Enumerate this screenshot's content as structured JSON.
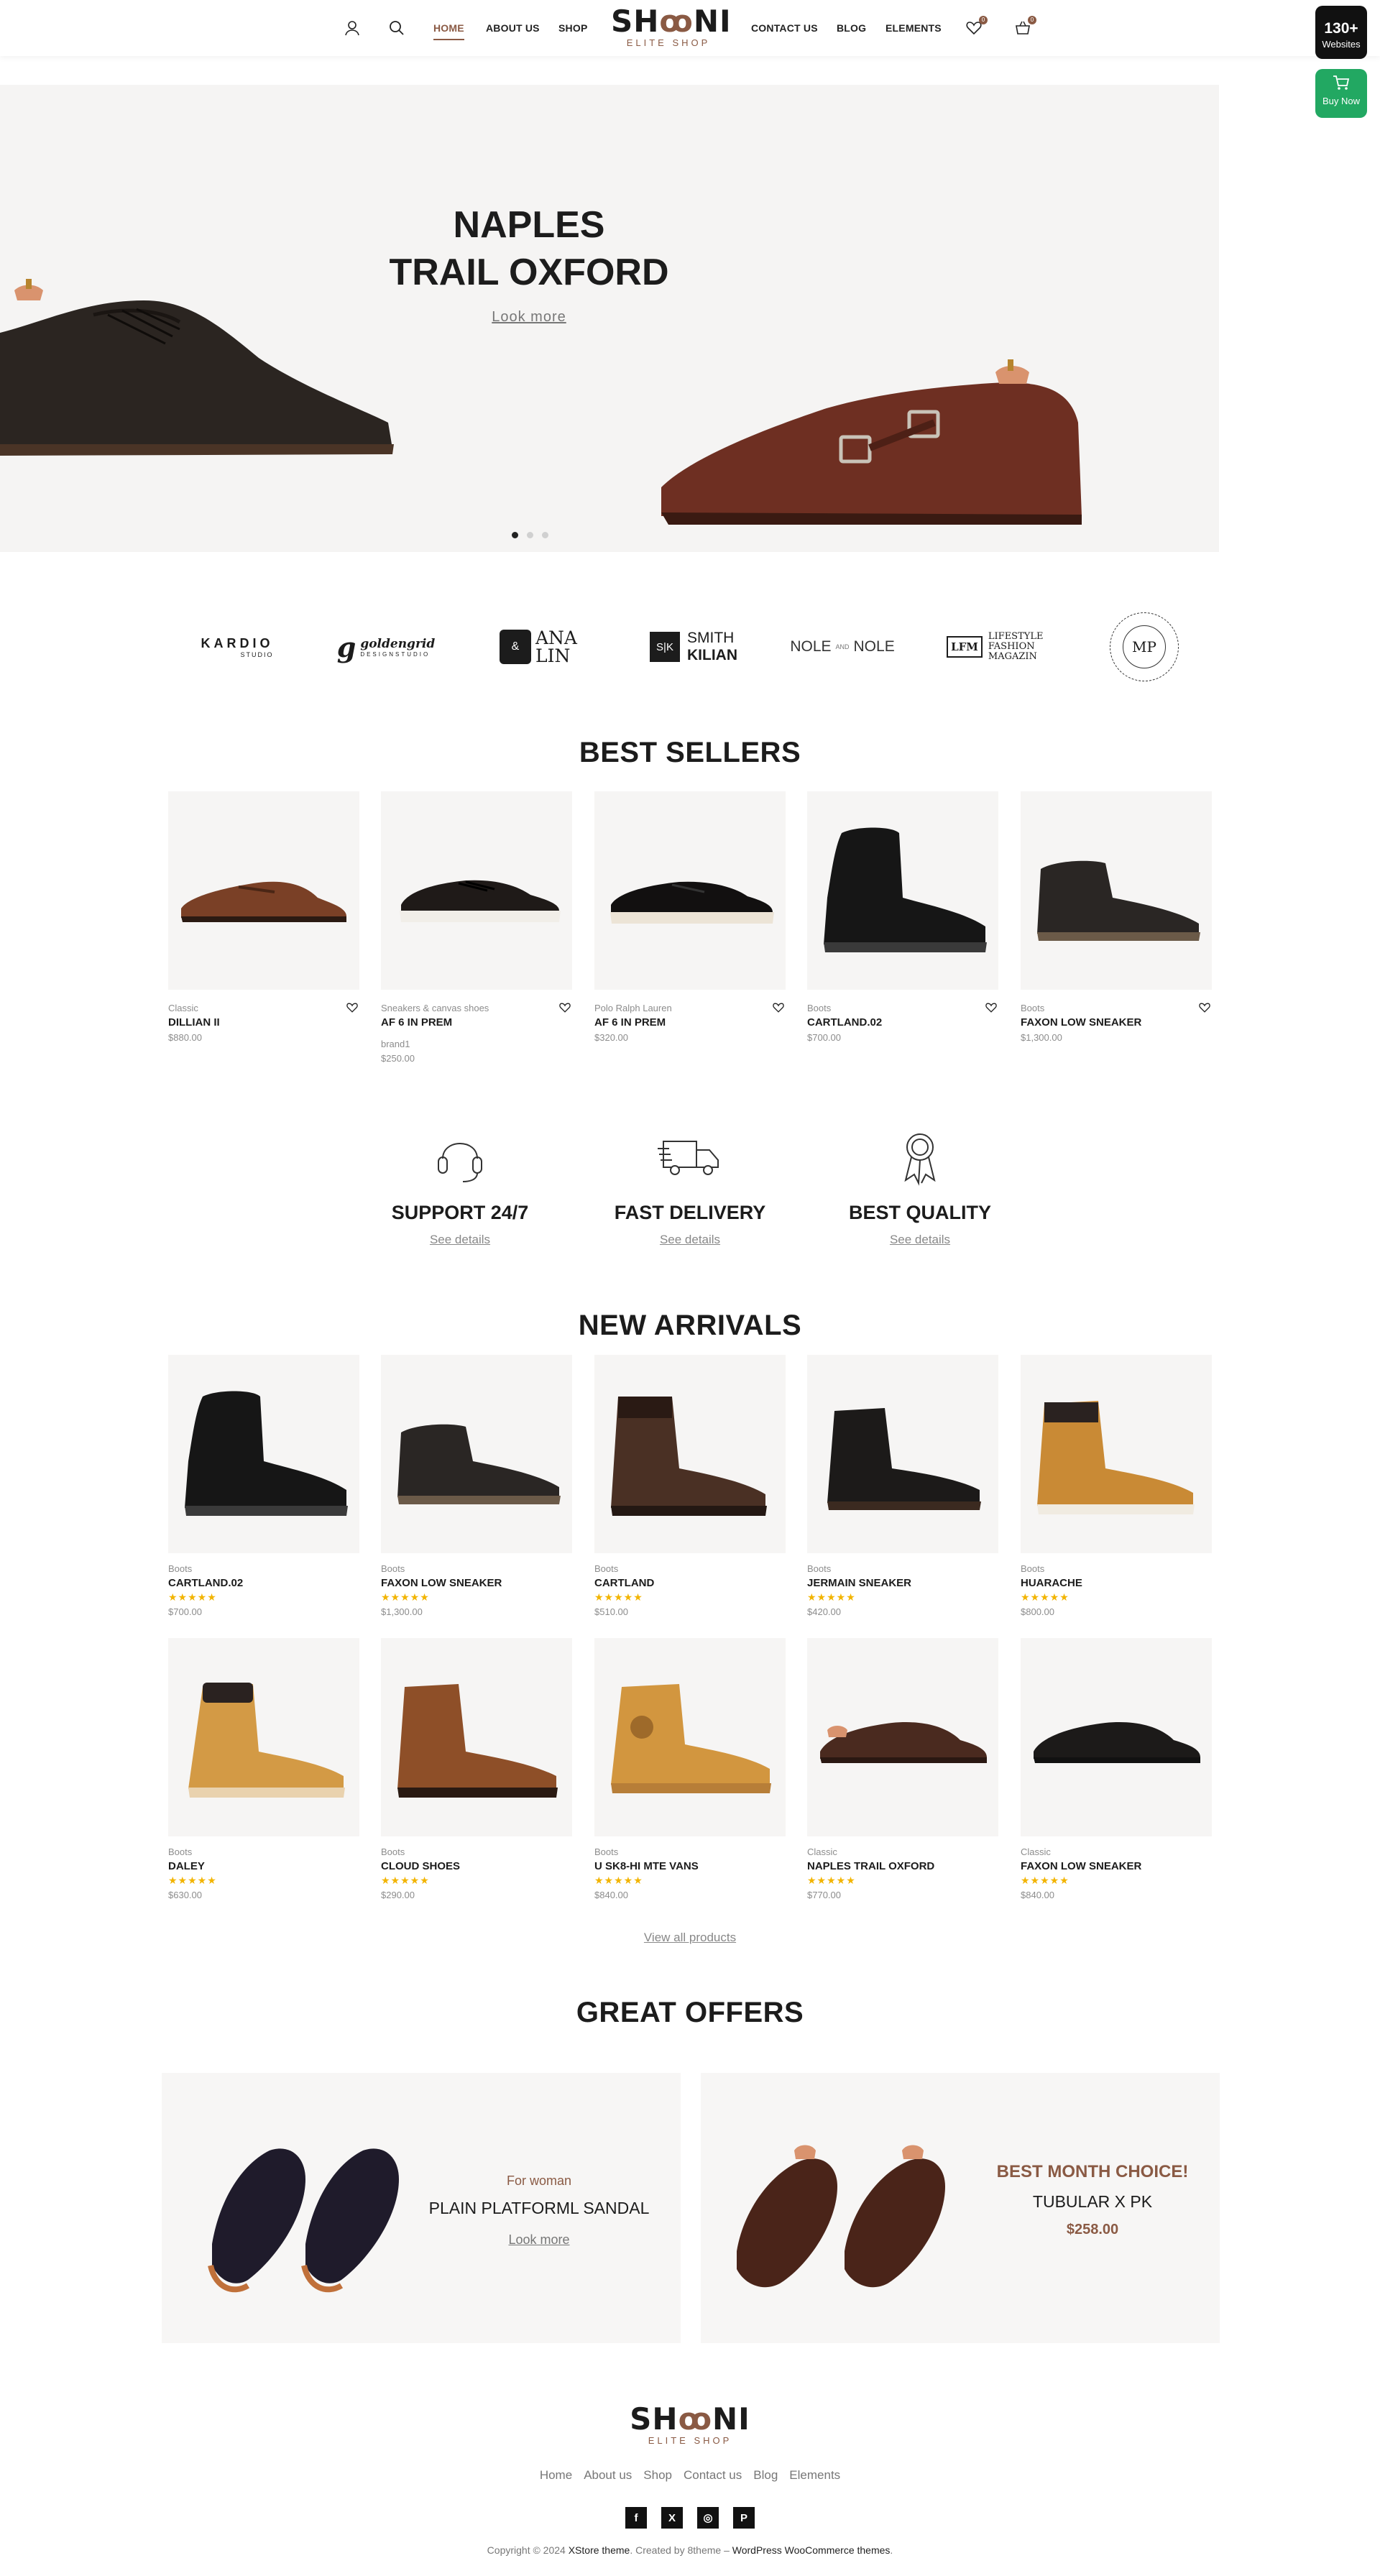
{
  "header": {
    "nav_left": [
      "HOME",
      "ABOUT US",
      "SHOP"
    ],
    "nav_right": [
      "CONTACT US",
      "BLOG",
      "ELEMENTS"
    ],
    "logo_text": "SHOONI",
    "logo_sub": "ELITE SHOP",
    "wishlist_count": "0",
    "cart_count": "0"
  },
  "side": {
    "websites_count": "130+",
    "websites_label": "Websites",
    "buy_label": "Buy Now"
  },
  "hero": {
    "title_line1": "NAPLES",
    "title_line2": "TRAIL OXFORD",
    "link": "Look more"
  },
  "brands": [
    {
      "name": "KARDIO",
      "sub": "STUDIO"
    },
    {
      "name": "goldengrid",
      "sub": "DESIGNSTUDIO"
    },
    {
      "name": "ANA LIN",
      "sub": ""
    },
    {
      "name": "SMITH",
      "sub": "KILIAN"
    },
    {
      "name": "NOLE",
      "sub": "NOLE"
    },
    {
      "name": "LIFESTYLE FASHION MAGAZIN",
      "sub": "LFM"
    },
    {
      "name": "MP",
      "sub": ""
    }
  ],
  "best_sellers": {
    "title": "BEST SELLERS",
    "items": [
      {
        "cat": "Classic",
        "name": "DILLIAN II",
        "price": "$880.00",
        "extra": ""
      },
      {
        "cat": "Sneakers & canvas shoes",
        "name": "AF 6 IN PREM",
        "price": "$250.00",
        "extra": "brand1"
      },
      {
        "cat": "Polo Ralph Lauren",
        "name": "AF 6 IN PREM",
        "price": "$320.00",
        "extra": ""
      },
      {
        "cat": "Boots",
        "name": "CARTLAND.02",
        "price": "$700.00",
        "extra": ""
      },
      {
        "cat": "Boots",
        "name": "FAXON LOW SNEAKER",
        "price": "$1,300.00",
        "extra": ""
      }
    ]
  },
  "features": [
    {
      "title": "SUPPORT 24/7",
      "link": "See details"
    },
    {
      "title": "FAST DELIVERY",
      "link": "See details"
    },
    {
      "title": "BEST QUALITY",
      "link": "See details"
    }
  ],
  "new_arrivals": {
    "title": "NEW ARRIVALS",
    "stars": "★★★★★",
    "items": [
      {
        "cat": "Boots",
        "name": "CARTLAND.02",
        "price": "$700.00"
      },
      {
        "cat": "Boots",
        "name": "FAXON LOW SNEAKER",
        "price": "$1,300.00"
      },
      {
        "cat": "Boots",
        "name": "CARTLAND",
        "price": "$510.00"
      },
      {
        "cat": "Boots",
        "name": "JERMAIN SNEAKER",
        "price": "$420.00"
      },
      {
        "cat": "Boots",
        "name": "HUARACHE",
        "price": "$800.00"
      },
      {
        "cat": "Boots",
        "name": "DALEY",
        "price": "$630.00"
      },
      {
        "cat": "Boots",
        "name": "CLOUD shoes",
        "price": "$290.00"
      },
      {
        "cat": "Boots",
        "name": "U SK8-HI MTE VANS",
        "price": "$840.00"
      },
      {
        "cat": "Classic",
        "name": "NAPLES TRAIL OXFORD",
        "price": "$770.00"
      },
      {
        "cat": "Classic",
        "name": "FAXON LOW SNEAKER",
        "price": "$840.00"
      }
    ],
    "view_all": "View all products"
  },
  "offers": {
    "title": "GREAT OFFERS",
    "left": {
      "sub": "For woman",
      "title": "PLAIN PLATFORML SANDAL",
      "link": "Look more"
    },
    "right": {
      "sub": "BEST MONTH CHOICE!",
      "title": "TUBULAR X PK",
      "price": "$258.00"
    }
  },
  "footer": {
    "links": [
      "Home",
      "About us",
      "Shop",
      "Contact us",
      "Blog",
      "Elements"
    ],
    "social": [
      "f",
      "X",
      "◎",
      "P"
    ],
    "copy_pre": "Copyright © 2024 ",
    "copy_theme": "XStore theme",
    "copy_mid": ". Created by 8theme – ",
    "copy_wp": "WordPress WooCommerce themes",
    "copy_end": "."
  },
  "colors": {
    "accent": "#8a5a44",
    "green": "#22a862",
    "star": "#f2b400"
  }
}
